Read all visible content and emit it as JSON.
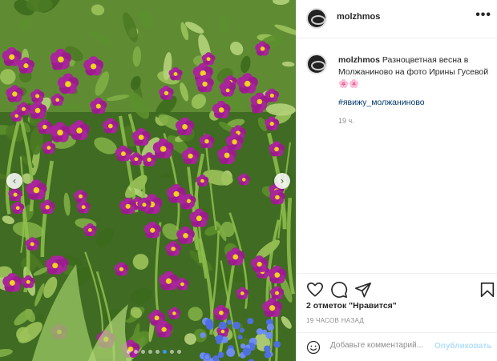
{
  "post": {
    "username": "molzhmos",
    "more_icon": "more-horizontal-icon",
    "caption_username": "molzhmos",
    "caption_text": "Разноцветная весна в Молжаниново на фото Ирины Гусевой 🌸🌸",
    "hashtag": "#явижу_молжаниново",
    "relative_time": "19 ч.",
    "likes_text": "2 отметок \"Нравится\"",
    "posted_ago": "19 ЧАСОВ НАЗАД",
    "comment_placeholder": "Добавьте комментарий...",
    "publish_label": "Опубликовать",
    "photo_alt": "Пурпурные примулы с жёлтой серединкой среди зелёной листвы",
    "carousel_left_icon": "chevron-left-icon",
    "carousel_right_icon": "chevron-right-icon",
    "carousel_left_glyph": "‹",
    "carousel_right_glyph": "›",
    "carousel_total": 8,
    "carousel_active": 6,
    "actions": [
      "heart-icon",
      "comment-icon",
      "share-icon",
      "bookmark-icon"
    ],
    "colors": {
      "link": "#00376b",
      "muted": "#8e8e8e",
      "publish_disabled": "#b2dffc",
      "border": "#efefef",
      "dot_active": "#3897f0"
    }
  }
}
